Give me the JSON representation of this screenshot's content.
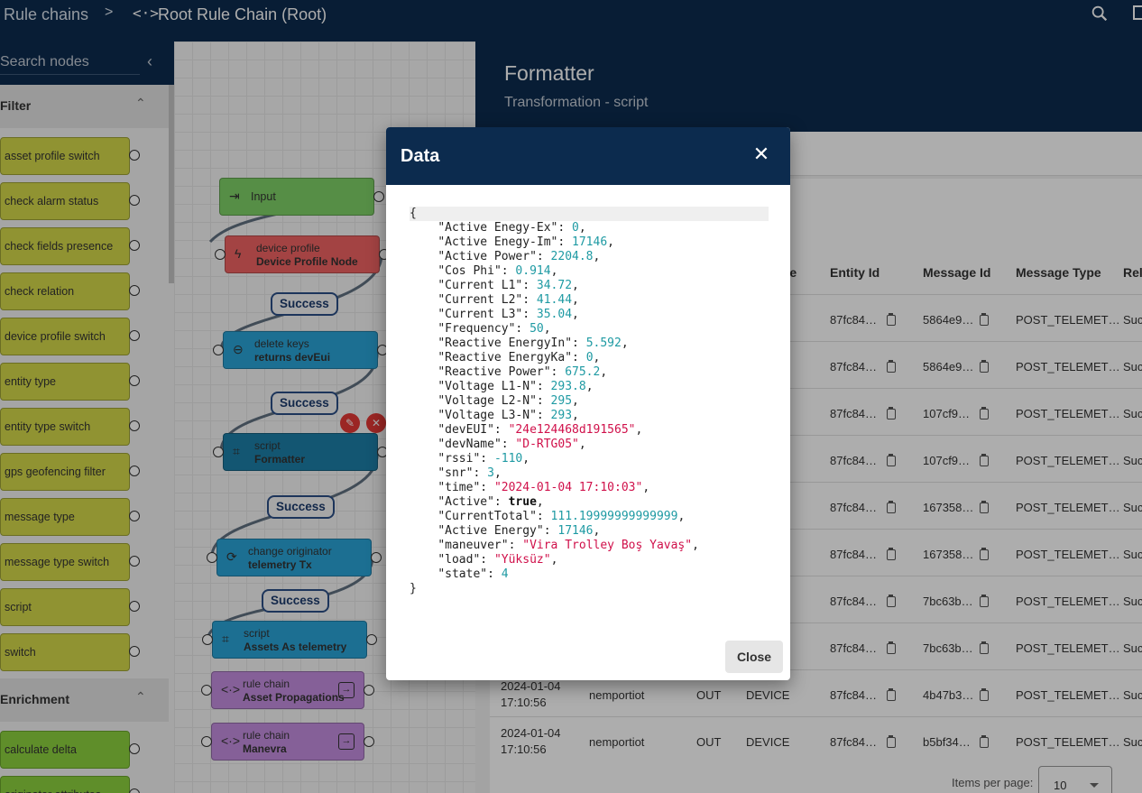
{
  "topbar": {
    "crumb_rule_chains": "Rule chains",
    "separator": ">",
    "rule_chain_icon": "<·>",
    "crumb_current": "Root Rule Chain (Root)",
    "icons": [
      "search-icon",
      "fullscreen-icon"
    ]
  },
  "library": {
    "search_placeholder": "Search nodes",
    "collapse_icon": "‹",
    "filter": {
      "title": "Filter",
      "chevron": "⌃",
      "items": [
        "asset profile switch",
        "check alarm status",
        "check fields presence",
        "check relation",
        "device profile switch",
        "entity type",
        "entity type switch",
        "gps geofencing filter",
        "message type",
        "message type switch",
        "script",
        "switch"
      ]
    },
    "enrichment": {
      "title": "Enrichment",
      "chevron": "⌃",
      "items": [
        "calculate delta",
        "originator attributes"
      ]
    },
    "item_prefix": "″"
  },
  "canvas": {
    "nodes": [
      {
        "type": "",
        "name": "Input",
        "icon": "⇥"
      },
      {
        "type": "device profile",
        "name": "Device Profile Node",
        "icon": "ϟ"
      },
      {
        "type": "delete keys",
        "name": "returns devEui",
        "icon": "⊖"
      },
      {
        "type": "script",
        "name": "Formatter",
        "icon": "⌗"
      },
      {
        "type": "change originator",
        "name": "telemetry Tx",
        "icon": "⟳"
      },
      {
        "type": "script",
        "name": "Assets As telemetry",
        "icon": "⌗"
      },
      {
        "type": "rule chain",
        "name": "Asset Propagations",
        "icon": "<·>"
      },
      {
        "type": "rule chain",
        "name": "Manevra",
        "icon": "<·>"
      }
    ],
    "link_labels": [
      "Success",
      "Success",
      "Success",
      "Success"
    ],
    "edit_icon": "✎",
    "delete_icon": "✕",
    "open_icon": "→"
  },
  "panel": {
    "title": "Formatter",
    "subtitle": "Transformation - script",
    "columns": [
      "ype",
      "Entity Id",
      "Message Id",
      "Message Type",
      "Rel"
    ],
    "rows": [
      {
        "date": "",
        "time": "",
        "server": "",
        "dir": "",
        "entity_type": "",
        "entity_id": "87fc84…",
        "message_id": "5864e9…",
        "message_type": "POST_TELEMET…",
        "rel": "Suc"
      },
      {
        "date": "",
        "time": "",
        "server": "",
        "dir": "",
        "entity_type": "",
        "entity_id": "87fc84…",
        "message_id": "5864e9…",
        "message_type": "POST_TELEMET…",
        "rel": "Suc"
      },
      {
        "date": "",
        "time": "",
        "server": "",
        "dir": "",
        "entity_type": "",
        "entity_id": "87fc84…",
        "message_id": "107cf9…",
        "message_type": "POST_TELEMET…",
        "rel": "Suc"
      },
      {
        "date": "",
        "time": "",
        "server": "",
        "dir": "",
        "entity_type": "",
        "entity_id": "87fc84…",
        "message_id": "107cf9…",
        "message_type": "POST_TELEMET…",
        "rel": "Suc"
      },
      {
        "date": "",
        "time": "",
        "server": "",
        "dir": "",
        "entity_type": "",
        "entity_id": "87fc84…",
        "message_id": "167358…",
        "message_type": "POST_TELEMET…",
        "rel": "Suc"
      },
      {
        "date": "",
        "time": "",
        "server": "",
        "dir": "",
        "entity_type": "",
        "entity_id": "87fc84…",
        "message_id": "167358…",
        "message_type": "POST_TELEMET…",
        "rel": "Suc"
      },
      {
        "date": "",
        "time": "",
        "server": "",
        "dir": "",
        "entity_type": "",
        "entity_id": "87fc84…",
        "message_id": "7bc63b…",
        "message_type": "POST_TELEMET…",
        "rel": "Suc"
      },
      {
        "date": "",
        "time": "",
        "server": "",
        "dir": "",
        "entity_type": "",
        "entity_id": "87fc84…",
        "message_id": "7bc63b…",
        "message_type": "POST_TELEMET…",
        "rel": "Suc"
      },
      {
        "date": "2024-01-04",
        "time": "17:10:56",
        "server": "nemportiot",
        "dir": "OUT",
        "entity_type": "DEVICE",
        "entity_id": "87fc84…",
        "message_id": "4b47b3…",
        "message_type": "POST_TELEMET…",
        "rel": "Suc"
      },
      {
        "date": "2024-01-04",
        "time": "17:10:56",
        "server": "nemportiot",
        "dir": "OUT",
        "entity_type": "DEVICE",
        "entity_id": "87fc84…",
        "message_id": "b5bf34…",
        "message_type": "POST_TELEMET…",
        "rel": "Suc"
      }
    ],
    "items_per_page_label": "Items per page:",
    "items_per_page_value": "10"
  },
  "dialog": {
    "title": "Data",
    "close_icon": "✕",
    "close_button": "Close",
    "json_open": "{",
    "json_close": "}",
    "json_fields": [
      {
        "key": "Active Enegy-Ex",
        "value": "0",
        "kind": "n"
      },
      {
        "key": "Active Enegy-Im",
        "value": "17146",
        "kind": "n"
      },
      {
        "key": "Active Power",
        "value": "2204.8",
        "kind": "n"
      },
      {
        "key": "Cos Phi",
        "value": "0.914",
        "kind": "n"
      },
      {
        "key": "Current L1",
        "value": "34.72",
        "kind": "n"
      },
      {
        "key": "Current L2",
        "value": "41.44",
        "kind": "n"
      },
      {
        "key": "Current L3",
        "value": "35.04",
        "kind": "n"
      },
      {
        "key": "Frequency",
        "value": "50",
        "kind": "n"
      },
      {
        "key": "Reactive EnergyIn",
        "value": "5.592",
        "kind": "n"
      },
      {
        "key": "Reactive EnergyKa",
        "value": "0",
        "kind": "n"
      },
      {
        "key": "Reactive Power",
        "value": "675.2",
        "kind": "n"
      },
      {
        "key": "Voltage L1-N",
        "value": "293.8",
        "kind": "n"
      },
      {
        "key": "Voltage L2-N",
        "value": "295",
        "kind": "n"
      },
      {
        "key": "Voltage L3-N",
        "value": "293",
        "kind": "n"
      },
      {
        "key": "devEUI",
        "value": "\"24e124468d191565\"",
        "kind": "s"
      },
      {
        "key": "devName",
        "value": "\"D-RTG05\"",
        "kind": "s"
      },
      {
        "key": "rssi",
        "value": "-110",
        "kind": "n"
      },
      {
        "key": "snr",
        "value": "3",
        "kind": "n"
      },
      {
        "key": "time",
        "value": "\"2024-01-04 17:10:03\"",
        "kind": "s"
      },
      {
        "key": "Active",
        "value": "true",
        "kind": "b"
      },
      {
        "key": "CurrentTotal",
        "value": "111.19999999999999",
        "kind": "n"
      },
      {
        "key": "Active Energy",
        "value": "17146",
        "kind": "n"
      },
      {
        "key": "maneuver",
        "value": "\"Vira Trolley Boş Yavaş\"",
        "kind": "s"
      },
      {
        "key": "load",
        "value": "\"Yüksüz\"",
        "kind": "s"
      },
      {
        "key": "state",
        "value": "4",
        "kind": "n"
      }
    ]
  },
  "colors": {
    "primary": "#0c2b4e",
    "filter_node": "#d5d94a",
    "enrichment_node": "#8dd13f",
    "json_number": "#1e9aa3",
    "json_string": "#d0104a"
  }
}
